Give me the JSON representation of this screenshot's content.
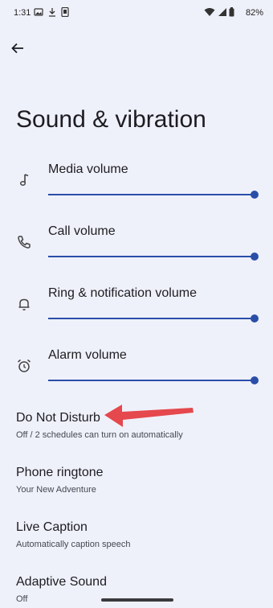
{
  "status_bar": {
    "time": "1:31",
    "battery_percent": "82%"
  },
  "header": {
    "title": "Sound & vibration"
  },
  "volumes": [
    {
      "label": "Media volume",
      "icon": "music-note-icon",
      "level": 1.0
    },
    {
      "label": "Call volume",
      "icon": "phone-icon",
      "level": 1.0
    },
    {
      "label": "Ring & notification volume",
      "icon": "bell-icon",
      "level": 1.0
    },
    {
      "label": "Alarm volume",
      "icon": "alarm-clock-icon",
      "level": 1.0
    }
  ],
  "preferences": [
    {
      "title": "Do Not Disturb",
      "subtitle": "Off / 2 schedules can turn on automatically"
    },
    {
      "title": "Phone ringtone",
      "subtitle": "Your New Adventure"
    },
    {
      "title": "Live Caption",
      "subtitle": "Automatically caption speech"
    },
    {
      "title": "Adaptive Sound",
      "subtitle": "Off"
    }
  ],
  "colors": {
    "background": "#eff1fa",
    "accent": "#2a4ea8",
    "annotation_arrow": "#e5484d"
  }
}
